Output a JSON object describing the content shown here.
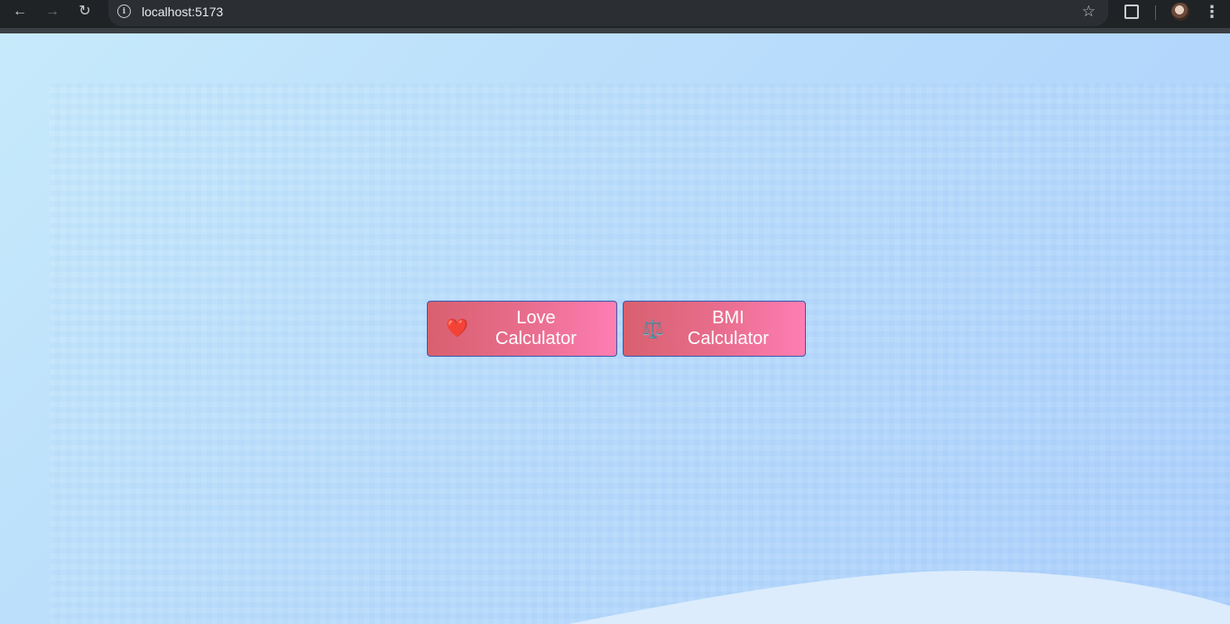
{
  "browser": {
    "url": "localhost:5173",
    "icons": {
      "back": "arrow-left-icon",
      "forward": "arrow-right-icon",
      "reload": "reload-icon",
      "info": "info-icon",
      "bookmark": "star-icon",
      "extensions": "puzzle-icon",
      "profile": "avatar",
      "menu": "kebab-menu-icon"
    }
  },
  "main": {
    "buttons": [
      {
        "emoji": "❤️",
        "label": "Love Calculator"
      },
      {
        "emoji": "⚖️",
        "label": "BMI Calculator"
      }
    ]
  },
  "colors": {
    "button_gradient_start": "#d8606e",
    "button_gradient_end": "#fe7eb3",
    "button_border": "#3b5aa8",
    "background": "#b8dcfb"
  }
}
